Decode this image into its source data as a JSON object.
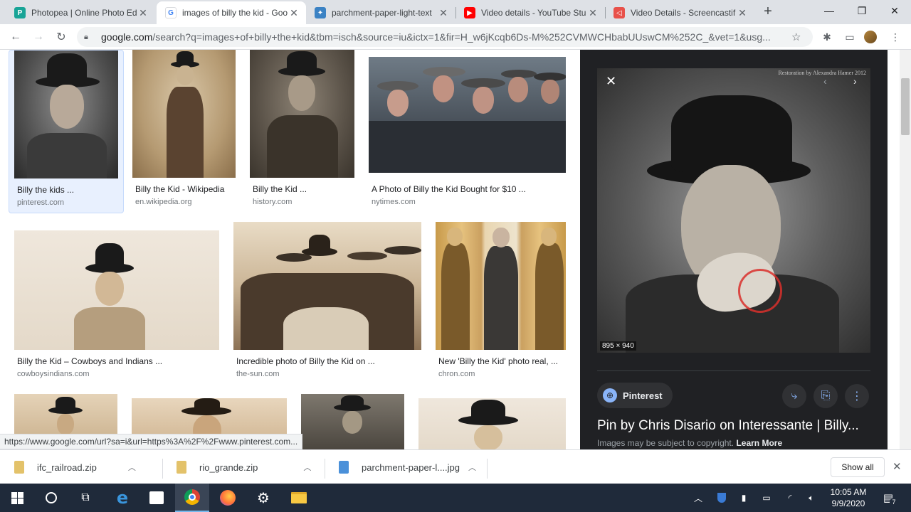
{
  "tabs": [
    {
      "title": "Photopea | Online Photo Ed",
      "favicon": "photopea-icon",
      "color": "#18a497",
      "active": false
    },
    {
      "title": "images of billy the kid - Goo",
      "favicon": "google-icon",
      "color": "#4285f4",
      "active": true
    },
    {
      "title": "parchment-paper-light-text",
      "favicon": "puzzle-favicon-icon",
      "color": "#3b82c4",
      "active": false
    },
    {
      "title": "Video details - YouTube Stu",
      "favicon": "youtube-icon",
      "color": "#ff0000",
      "active": false
    },
    {
      "title": "Video Details - Screencastif",
      "favicon": "screencastify-icon",
      "color": "#e8514a",
      "active": false
    }
  ],
  "tab_close": "✕",
  "new_tab": "+",
  "window": {
    "minimize": "—",
    "restore": "❐",
    "close": "✕"
  },
  "nav": {
    "back": "←",
    "forward": "→",
    "reload": "↻"
  },
  "omnibox": {
    "host": "google.com",
    "path": "/search?q=images+of+billy+the+kid&tbm=isch&source=iu&ictx=1&fir=H_w6jKcqb6Ds-M%252CVMWCHbabUUswCM%252C_&vet=1&usg..."
  },
  "toolbar_icons": {
    "star": "☆",
    "extensions": "✱",
    "cast": "▭",
    "menu": "⋮"
  },
  "results": [
    {
      "caption": "Billy the kids ...",
      "source": "pinterest.com"
    },
    {
      "caption": "Billy the Kid - Wikipedia",
      "source": "en.wikipedia.org"
    },
    {
      "caption": "Billy the Kid ...",
      "source": "history.com"
    },
    {
      "caption": "A Photo of Billy the Kid Bought for $10 ...",
      "source": "nytimes.com"
    },
    {
      "caption": "Billy the Kid – Cowboys and Indians ...",
      "source": "cowboysindians.com"
    },
    {
      "caption": "Incredible photo of Billy the Kid on ...",
      "source": "the-sun.com"
    },
    {
      "caption": "New 'Billy the Kid' photo real, ...",
      "source": "chron.com"
    }
  ],
  "panel": {
    "close": "✕",
    "watermark": "Restoration by Alexandra Hamer 2012",
    "dimensions": "895 × 940",
    "source_chip": "Pinterest",
    "title": "Pin by Chris Disario on Interessante | Billy...",
    "copyright": "Images may be subject to copyright.",
    "learn_more": "Learn More"
  },
  "status_url": "https://www.google.com/url?sa=i&url=https%3A%2F%2Fwww.pinterest.com...",
  "downloads": [
    {
      "name": "ifc_railroad.zip"
    },
    {
      "name": "rio_grande.zip"
    },
    {
      "name": "parchment-paper-l....jpg"
    }
  ],
  "show_all": "Show all",
  "shelf_close": "✕",
  "taskbar": {
    "time": "10:05 AM",
    "date": "9/9/2020",
    "notifications": "7"
  }
}
